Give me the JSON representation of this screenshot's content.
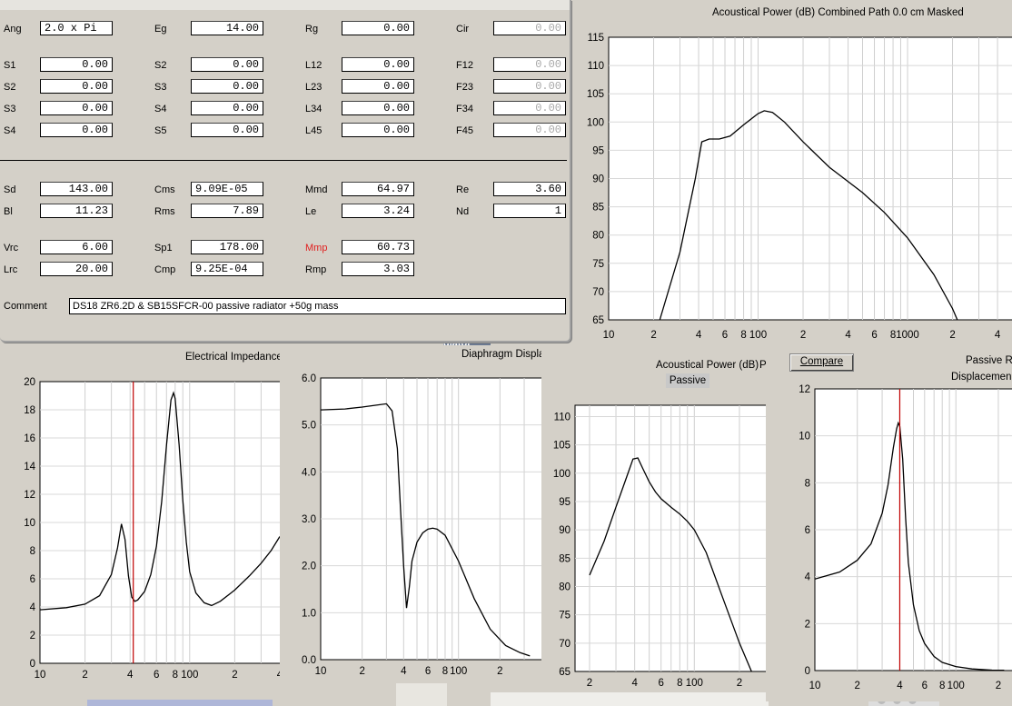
{
  "params": {
    "ang": {
      "label": "Ang",
      "value": "2.0 x Pi"
    },
    "eg": {
      "label": "Eg",
      "value": "14.00"
    },
    "rg": {
      "label": "Rg",
      "value": "0.00"
    },
    "cir": {
      "label": "Cir",
      "value": "0.00"
    },
    "rows": [
      {
        "c1": [
          "S1",
          "0.00"
        ],
        "c2": [
          "S2",
          "0.00"
        ],
        "c3": [
          "L12",
          "0.00"
        ],
        "c4": [
          "F12",
          "0.00"
        ]
      },
      {
        "c1": [
          "S2",
          "0.00"
        ],
        "c2": [
          "S3",
          "0.00"
        ],
        "c3": [
          "L23",
          "0.00"
        ],
        "c4": [
          "F23",
          "0.00"
        ]
      },
      {
        "c1": [
          "S3",
          "0.00"
        ],
        "c2": [
          "S4",
          "0.00"
        ],
        "c3": [
          "L34",
          "0.00"
        ],
        "c4": [
          "F34",
          "0.00"
        ]
      },
      {
        "c1": [
          "S4",
          "0.00"
        ],
        "c2": [
          "S5",
          "0.00"
        ],
        "c3": [
          "L45",
          "0.00"
        ],
        "c4": [
          "F45",
          "0.00"
        ]
      }
    ],
    "driver": {
      "sd": {
        "label": "Sd",
        "value": "143.00"
      },
      "cms": {
        "label": "Cms",
        "value": "9.09E-05"
      },
      "mmd": {
        "label": "Mmd",
        "value": "64.97"
      },
      "re": {
        "label": "Re",
        "value": "3.60"
      },
      "bl": {
        "label": "Bl",
        "value": "11.23"
      },
      "rms": {
        "label": "Rms",
        "value": "7.89"
      },
      "le": {
        "label": "Le",
        "value": "3.24"
      },
      "nd": {
        "label": "Nd",
        "value": "1"
      },
      "vrc": {
        "label": "Vrc",
        "value": "6.00"
      },
      "sp1": {
        "label": "Sp1",
        "value": "178.00"
      },
      "mmp": {
        "label": "Mmp",
        "value": "60.73"
      },
      "lrc": {
        "label": "Lrc",
        "value": "20.00"
      },
      "cmp": {
        "label": "Cmp",
        "value": "9.25E-04"
      },
      "rmp": {
        "label": "Rmp",
        "value": "3.03"
      }
    },
    "comment_label": "Comment",
    "comment_value": "DS18 ZR6.2D & SB15SFCR-00 passive radiator +50g mass",
    "highlight_color": "#e02020"
  },
  "buttons": {
    "compare": "Compare",
    "passive_tab": "Passive"
  },
  "background_text": "diator",
  "chart_data": [
    {
      "id": "acoustical-power-combined",
      "type": "line",
      "title": "Acoustical Power (dB)   Combined   Path 0.0 cm    Masked",
      "x_scale": "log",
      "xlim": [
        10,
        5000
      ],
      "ylim": [
        65,
        115
      ],
      "yticks": [
        65,
        70,
        75,
        80,
        85,
        90,
        95,
        100,
        105,
        110,
        115
      ],
      "xtick_labels": [
        "10",
        "2",
        "4",
        "6",
        "8",
        "100",
        "2",
        "4",
        "6",
        "8",
        "1000",
        "2",
        "4"
      ],
      "x": [
        22,
        30,
        38,
        42,
        47,
        55,
        65,
        80,
        100,
        110,
        125,
        150,
        200,
        300,
        500,
        700,
        1000,
        1500,
        2000,
        2500,
        3000,
        3500
      ],
      "y": [
        65,
        77,
        90,
        96.5,
        97,
        97,
        97.5,
        99.5,
        101.5,
        102,
        101.7,
        100,
        96.5,
        92,
        87.5,
        84,
        79.5,
        73,
        67,
        61,
        56,
        52
      ]
    },
    {
      "id": "electrical-impedance",
      "type": "line",
      "title": "Electrical Impedance",
      "x_scale": "log",
      "xlim": [
        10,
        400
      ],
      "ylim": [
        0,
        20
      ],
      "yticks": [
        0,
        2,
        4,
        6,
        8,
        10,
        12,
        14,
        16,
        18,
        20
      ],
      "xtick_labels": [
        "10",
        "2",
        "4",
        "6",
        "8",
        "100",
        "2",
        "4"
      ],
      "marker_x": 42,
      "x": [
        10,
        15,
        20,
        25,
        30,
        33,
        35,
        37,
        39,
        41,
        43,
        45,
        50,
        55,
        60,
        65,
        70,
        75,
        78,
        80,
        85,
        90,
        95,
        100,
        110,
        125,
        140,
        160,
        200,
        250,
        300,
        350,
        400
      ],
      "y": [
        3.8,
        3.95,
        4.2,
        4.8,
        6.3,
        8.2,
        9.9,
        8.8,
        6.2,
        4.7,
        4.4,
        4.5,
        5.1,
        6.3,
        8.3,
        11.5,
        15.5,
        18.7,
        19.2,
        18.8,
        15.5,
        11.6,
        8.6,
        6.5,
        5.0,
        4.3,
        4.1,
        4.4,
        5.2,
        6.2,
        7.1,
        8.0,
        9.0
      ]
    },
    {
      "id": "diaphragm-displacement",
      "type": "line",
      "title": "Diaphragm Displacement",
      "x_scale": "log",
      "xlim": [
        10,
        400
      ],
      "ylim": [
        0,
        6
      ],
      "yticks": [
        0,
        1,
        2,
        3,
        4,
        5,
        6
      ],
      "ytick_labels": [
        "0.0",
        "1.0",
        "2.0",
        "3.0",
        "4.0",
        "5.0",
        "6.0"
      ],
      "xtick_labels": [
        "10",
        "2",
        "4",
        "6",
        "8",
        "100",
        "2"
      ],
      "x": [
        10,
        15,
        20,
        25,
        30,
        33,
        36,
        38,
        40,
        42,
        44,
        46,
        50,
        55,
        60,
        65,
        70,
        80,
        100,
        130,
        170,
        220,
        280,
        330
      ],
      "y": [
        5.32,
        5.34,
        5.38,
        5.42,
        5.45,
        5.3,
        4.5,
        3.2,
        2.0,
        1.1,
        1.55,
        2.1,
        2.5,
        2.7,
        2.78,
        2.8,
        2.78,
        2.65,
        2.1,
        1.3,
        0.65,
        0.3,
        0.15,
        0.08
      ]
    },
    {
      "id": "acoustical-power-passive",
      "type": "line",
      "title": "Acoustical Power (dB)",
      "subtitle": "Passive",
      "x_scale": "log",
      "xlim": [
        16,
        300
      ],
      "ylim": [
        65,
        112
      ],
      "yticks": [
        65,
        70,
        75,
        80,
        85,
        90,
        95,
        100,
        105,
        110
      ],
      "xtick_labels": [
        "2",
        "4",
        "6",
        "8",
        "100",
        "2"
      ],
      "x": [
        20,
        25,
        30,
        35,
        39,
        42,
        45,
        50,
        55,
        60,
        70,
        80,
        90,
        100,
        120,
        150,
        200,
        250
      ],
      "y": [
        82,
        88,
        94,
        99,
        102.5,
        102.7,
        101,
        98.5,
        96.7,
        95.5,
        94,
        92.8,
        91.5,
        90,
        86,
        79,
        70,
        64
      ]
    },
    {
      "id": "passive-radiator-displacement",
      "type": "line",
      "title": "Passive Ra",
      "subtitle": "Displacemen",
      "x_scale": "log",
      "xlim": [
        10,
        250
      ],
      "ylim": [
        0,
        12
      ],
      "yticks": [
        0,
        2,
        4,
        6,
        8,
        10,
        12
      ],
      "xtick_labels": [
        "10",
        "2",
        "4",
        "6",
        "8",
        "100",
        "2"
      ],
      "marker_x": 40,
      "x": [
        10,
        15,
        20,
        25,
        30,
        33,
        36,
        38,
        39,
        40,
        42,
        44,
        46,
        50,
        55,
        60,
        70,
        80,
        100,
        130,
        180,
        220
      ],
      "y": [
        3.9,
        4.2,
        4.7,
        5.4,
        6.7,
        7.9,
        9.5,
        10.3,
        10.55,
        10.4,
        9.0,
        6.5,
        4.6,
        2.8,
        1.7,
        1.15,
        0.6,
        0.35,
        0.17,
        0.07,
        0.02,
        0.01
      ]
    }
  ]
}
